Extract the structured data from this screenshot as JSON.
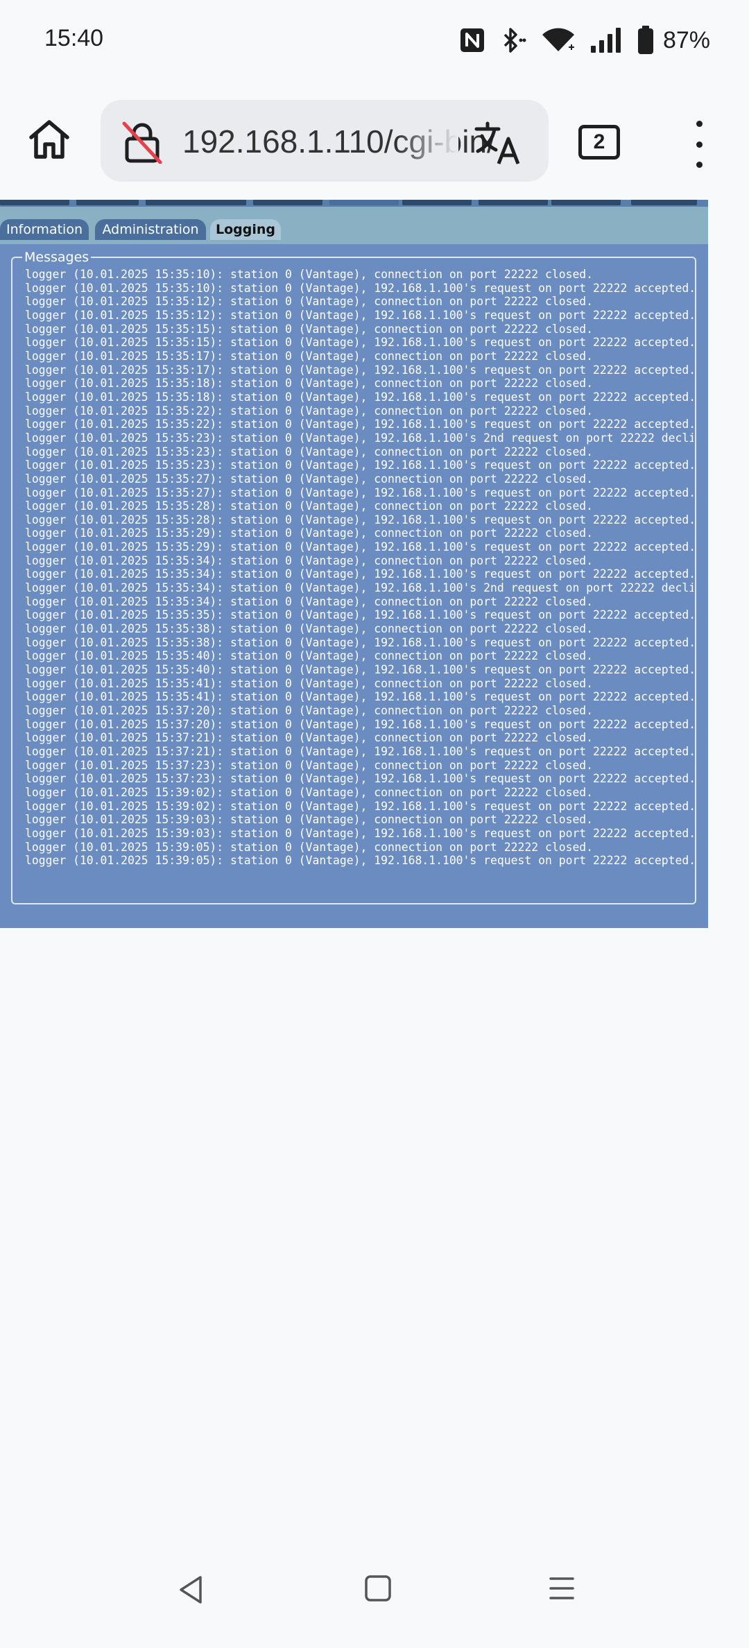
{
  "status_bar": {
    "time": "15:40",
    "battery_percent": "87%",
    "icons": [
      "nfc-icon",
      "bluetooth-icon",
      "wifi-icon",
      "signal-icon",
      "battery-icon"
    ]
  },
  "browser": {
    "url": "192.168.1.110/cgi-bin/",
    "tab_count": "2",
    "icons": [
      "home-icon",
      "insecure-lock-icon",
      "translate-icon",
      "tabs-icon",
      "more-vert-icon"
    ]
  },
  "page": {
    "sub_tabs": [
      {
        "label": "Information",
        "active": false
      },
      {
        "label": "Administration",
        "active": false
      },
      {
        "label": "Logging",
        "active": true
      }
    ],
    "messages_legend": "Messages",
    "log_lines": [
      "logger (10.01.2025 15:35:10): station 0 (Vantage), connection on port 22222 closed.",
      "logger (10.01.2025 15:35:10): station 0 (Vantage), 192.168.1.100's request on port 22222 accepted.",
      "logger (10.01.2025 15:35:12): station 0 (Vantage), connection on port 22222 closed.",
      "logger (10.01.2025 15:35:12): station 0 (Vantage), 192.168.1.100's request on port 22222 accepted.",
      "logger (10.01.2025 15:35:15): station 0 (Vantage), connection on port 22222 closed.",
      "logger (10.01.2025 15:35:15): station 0 (Vantage), 192.168.1.100's request on port 22222 accepted.",
      "logger (10.01.2025 15:35:17): station 0 (Vantage), connection on port 22222 closed.",
      "logger (10.01.2025 15:35:17): station 0 (Vantage), 192.168.1.100's request on port 22222 accepted.",
      "logger (10.01.2025 15:35:18): station 0 (Vantage), connection on port 22222 closed.",
      "logger (10.01.2025 15:35:18): station 0 (Vantage), 192.168.1.100's request on port 22222 accepted.",
      "logger (10.01.2025 15:35:22): station 0 (Vantage), connection on port 22222 closed.",
      "logger (10.01.2025 15:35:22): station 0 (Vantage), 192.168.1.100's request on port 22222 accepted.",
      "logger (10.01.2025 15:35:23): station 0 (Vantage), 192.168.1.100's 2nd request on port 22222 decli",
      "logger (10.01.2025 15:35:23): station 0 (Vantage), connection on port 22222 closed.",
      "logger (10.01.2025 15:35:23): station 0 (Vantage), 192.168.1.100's request on port 22222 accepted.",
      "logger (10.01.2025 15:35:27): station 0 (Vantage), connection on port 22222 closed.",
      "logger (10.01.2025 15:35:27): station 0 (Vantage), 192.168.1.100's request on port 22222 accepted.",
      "logger (10.01.2025 15:35:28): station 0 (Vantage), connection on port 22222 closed.",
      "logger (10.01.2025 15:35:28): station 0 (Vantage), 192.168.1.100's request on port 22222 accepted.",
      "logger (10.01.2025 15:35:29): station 0 (Vantage), connection on port 22222 closed.",
      "logger (10.01.2025 15:35:29): station 0 (Vantage), 192.168.1.100's request on port 22222 accepted.",
      "logger (10.01.2025 15:35:34): station 0 (Vantage), connection on port 22222 closed.",
      "logger (10.01.2025 15:35:34): station 0 (Vantage), 192.168.1.100's request on port 22222 accepted.",
      "logger (10.01.2025 15:35:34): station 0 (Vantage), 192.168.1.100's 2nd request on port 22222 decli",
      "logger (10.01.2025 15:35:34): station 0 (Vantage), connection on port 22222 closed.",
      "logger (10.01.2025 15:35:35): station 0 (Vantage), 192.168.1.100's request on port 22222 accepted.",
      "logger (10.01.2025 15:35:38): station 0 (Vantage), connection on port 22222 closed.",
      "logger (10.01.2025 15:35:38): station 0 (Vantage), 192.168.1.100's request on port 22222 accepted.",
      "logger (10.01.2025 15:35:40): station 0 (Vantage), connection on port 22222 closed.",
      "logger (10.01.2025 15:35:40): station 0 (Vantage), 192.168.1.100's request on port 22222 accepted.",
      "logger (10.01.2025 15:35:41): station 0 (Vantage), connection on port 22222 closed.",
      "logger (10.01.2025 15:35:41): station 0 (Vantage), 192.168.1.100's request on port 22222 accepted.",
      "logger (10.01.2025 15:37:20): station 0 (Vantage), connection on port 22222 closed.",
      "logger (10.01.2025 15:37:20): station 0 (Vantage), 192.168.1.100's request on port 22222 accepted.",
      "logger (10.01.2025 15:37:21): station 0 (Vantage), connection on port 22222 closed.",
      "logger (10.01.2025 15:37:21): station 0 (Vantage), 192.168.1.100's request on port 22222 accepted.",
      "logger (10.01.2025 15:37:23): station 0 (Vantage), connection on port 22222 closed.",
      "logger (10.01.2025 15:37:23): station 0 (Vantage), 192.168.1.100's request on port 22222 accepted.",
      "logger (10.01.2025 15:39:02): station 0 (Vantage), connection on port 22222 closed.",
      "logger (10.01.2025 15:39:02): station 0 (Vantage), 192.168.1.100's request on port 22222 accepted.",
      "logger (10.01.2025 15:39:03): station 0 (Vantage), connection on port 22222 closed.",
      "logger (10.01.2025 15:39:03): station 0 (Vantage), 192.168.1.100's request on port 22222 accepted.",
      "logger (10.01.2025 15:39:05): station 0 (Vantage), connection on port 22222 closed.",
      "logger (10.01.2025 15:39:05): station 0 (Vantage), 192.168.1.100's request on port 22222 accepted."
    ]
  },
  "nav_bar": {
    "icons": [
      "back-icon",
      "home-square-icon",
      "recents-icon"
    ]
  },
  "colors": {
    "page_bg": "#6b8cc0",
    "subtab_bar": "#8ab0c4",
    "subtab_active": "#a9c6d6",
    "subtab_inactive": "#4a6f9c",
    "log_text": "#ffffff",
    "browser_bg": "#f8f9fa"
  }
}
